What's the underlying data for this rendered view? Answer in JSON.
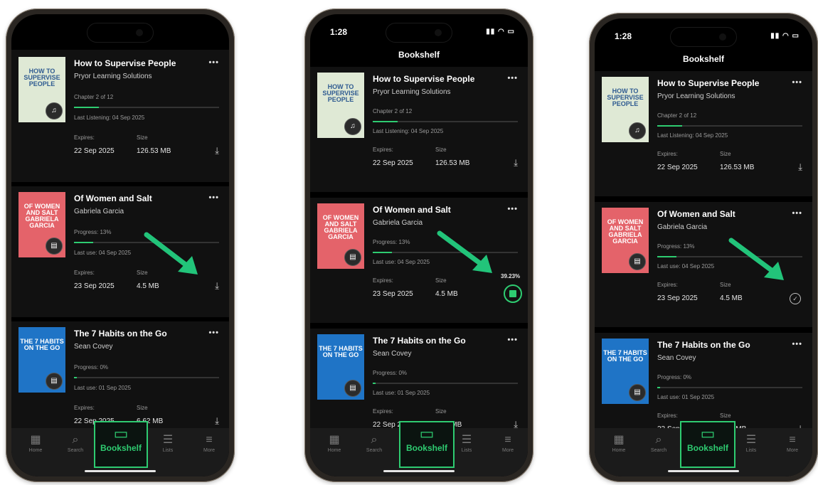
{
  "status": {
    "time": "1:28",
    "icons": "▮▮ ◠ ▭"
  },
  "header": {
    "title": "Bookshelf"
  },
  "books": [
    {
      "title": "How to Supervise People",
      "author": "Pryor Learning Solutions",
      "progress_text": "Chapter 2 of 12",
      "progress": 0.17,
      "last": "Last Listening: 04 Sep 2025",
      "expires_label": "Expires:",
      "expires": "22 Sep 2025",
      "size_label": "Size",
      "size": "126.53 MB",
      "cover_text": "HOW TO SUPERVISE PEOPLE",
      "cover_bg": "#dfe9d5",
      "cover_fg": "#2f5b91",
      "badge_icon": "headphones-icon",
      "badge_glyph": "♫"
    },
    {
      "title": "Of Women and Salt",
      "author": "Gabriela Garcia",
      "progress_text": "Progress: 13%",
      "progress": 0.13,
      "last": "Last use: 04 Sep 2025",
      "expires_label": "Expires:",
      "expires": "23 Sep 2025",
      "size_label": "Size",
      "size": "4.5 MB",
      "cover_text": "OF WOMEN AND SALT GABRIELA GARCIA",
      "cover_bg": "#e4636a",
      "cover_fg": "#ffffff",
      "badge_icon": "book-icon",
      "badge_glyph": "▤"
    },
    {
      "title": "The 7 Habits on the Go",
      "author": "Sean Covey",
      "progress_text": "Progress: 0%",
      "progress": 0.02,
      "last": "Last use: 01 Sep 2025",
      "expires_label": "Expires:",
      "expires": "22 Sep 2025",
      "size_label": "Size",
      "size": "6.62 MB",
      "cover_text": "THE 7 HABITS ON THE GO",
      "cover_bg": "#1f74c6",
      "cover_fg": "#ffffff",
      "badge_icon": "book-icon",
      "badge_glyph": "▤"
    }
  ],
  "download": {
    "percent": "39.23%"
  },
  "icons": {
    "more": "•••",
    "download": "⤓",
    "check": "✓"
  },
  "tabs": [
    {
      "label": "Home",
      "icon": "▦"
    },
    {
      "label": "Search",
      "icon": "⌕"
    },
    {
      "label": "Bookshelf",
      "icon": "▭"
    },
    {
      "label": "Lists",
      "icon": "☰"
    },
    {
      "label": "More",
      "icon": "≡"
    }
  ],
  "colors": {
    "accent": "#2ecc71",
    "bg": "#000000",
    "card": "#111111"
  }
}
